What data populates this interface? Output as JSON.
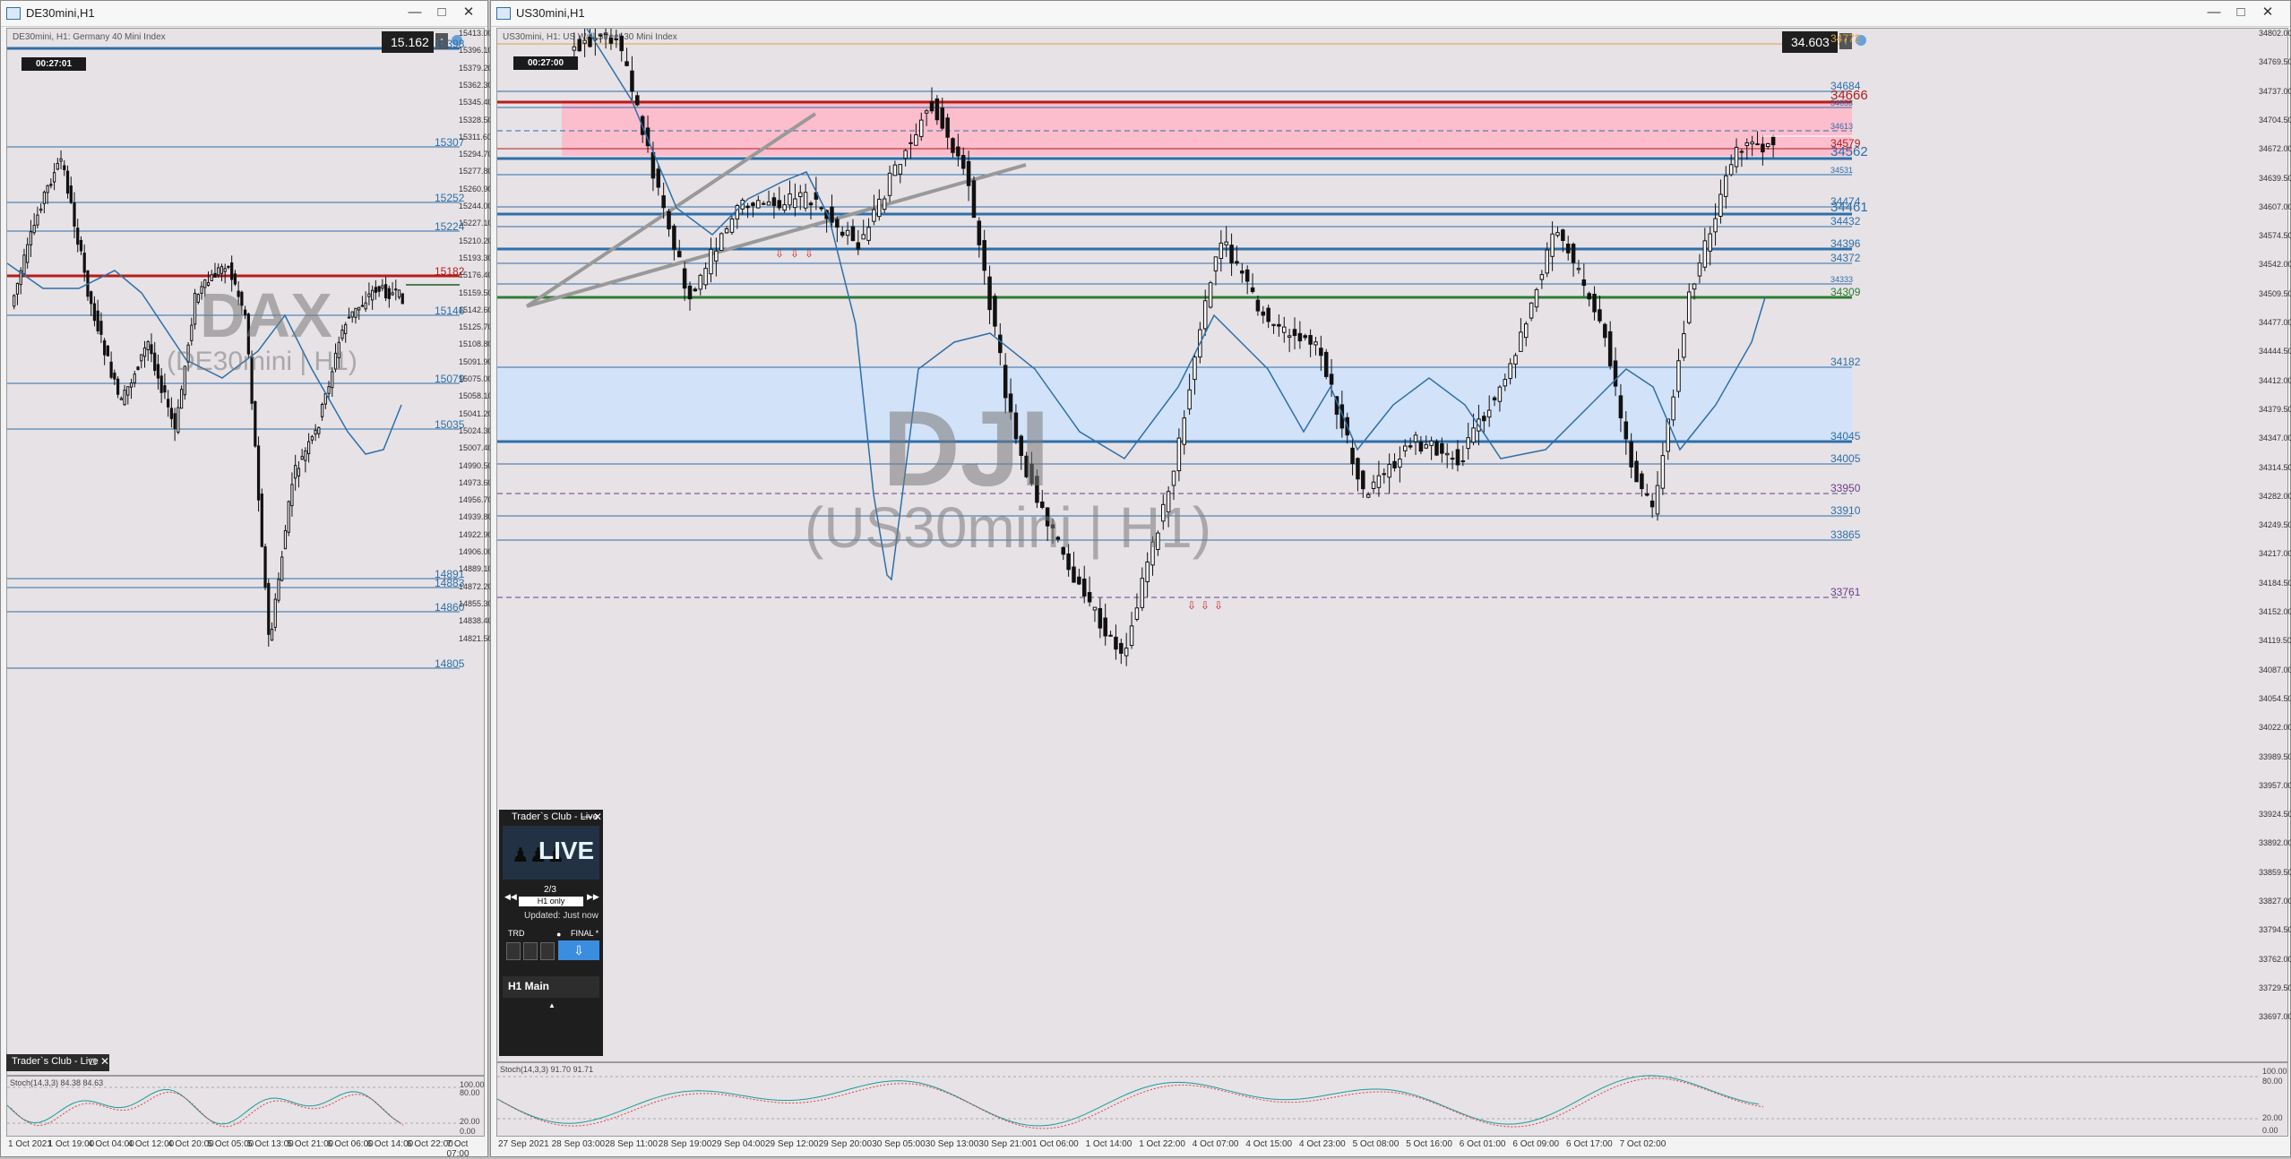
{
  "left": {
    "title": "DE30mini,H1",
    "info": "DE30mini, H1:  Germany 40 Mini Index",
    "timer": "00:27:01",
    "price": "15.162",
    "watermark_main": "DAX",
    "watermark_sub": "(DE30mini | H1)",
    "levels": [
      "15398",
      "15307",
      "15252",
      "15224",
      "15182",
      "15182",
      "15146",
      "15079",
      "15035",
      "14891",
      "14883",
      "14860",
      "14805"
    ],
    "price_axis": [
      "15413.00",
      "15396.10",
      "15379.20",
      "15362.30",
      "15345.40",
      "15328.50",
      "15311.60",
      "15294.70",
      "15277.80",
      "15260.90",
      "15244.00",
      "15227.10",
      "15210.20",
      "15193.30",
      "15176.40",
      "15159.50",
      "15142.60",
      "15125.70",
      "15108.80",
      "15091.90",
      "15075.00",
      "15058.10",
      "15041.20",
      "15024.30",
      "15007.40",
      "14990.50",
      "14973.60",
      "14956.70",
      "14939.80",
      "14922.90",
      "14906.00",
      "14889.10",
      "14872.20",
      "14855.30",
      "14838.40",
      "14821.50"
    ],
    "time_axis": [
      "1 Oct 2021",
      "1 Oct 19:00",
      "4 Oct 04:00",
      "4 Oct 12:00",
      "4 Oct 20:00",
      "5 Oct 05:00",
      "5 Oct 13:00",
      "5 Oct 21:00",
      "6 Oct 06:00",
      "6 Oct 14:00",
      "6 Oct 22:00",
      "7 Oct 07:00"
    ],
    "panel_title": "Trader`s Club - Live",
    "stoch_label": "Stoch(14,3,3) 84.38 84.63",
    "stoch_axis": [
      "100.00",
      "80.00",
      "20.00",
      "0.00"
    ]
  },
  "right": {
    "title": "US30mini,H1",
    "info": "US30mini, H1:  US Wall Street 30 Mini Index",
    "timer": "00:27:00",
    "price": "34.603",
    "watermark_main": "DJI",
    "watermark_sub": "(US30mini | H1)",
    "levels": [
      "34772",
      "34684",
      "34666",
      "34653",
      "34613",
      "34579",
      "34562",
      "34531",
      "34474",
      "34461",
      "34432",
      "34396",
      "34372",
      "34333",
      "34309",
      "34182",
      "34045",
      "34005",
      "33950",
      "33910",
      "33865",
      "33761"
    ],
    "price_axis": [
      "34802.00",
      "34769.50",
      "34737.00",
      "34704.50",
      "34672.00",
      "34639.50",
      "34607.00",
      "34574.50",
      "34542.00",
      "34509.50",
      "34477.00",
      "34444.50",
      "34412.00",
      "34379.50",
      "34347.00",
      "34314.50",
      "34282.00",
      "34249.50",
      "34217.00",
      "34184.50",
      "34152.00",
      "34119.50",
      "34087.00",
      "34054.50",
      "34022.00",
      "33989.50",
      "33957.00",
      "33924.50",
      "33892.00",
      "33859.50",
      "33827.00",
      "33794.50",
      "33762.00",
      "33729.50",
      "33697.00"
    ],
    "time_axis": [
      "27 Sep 2021",
      "28 Sep 03:00",
      "28 Sep 11:00",
      "28 Sep 19:00",
      "29 Sep 04:00",
      "29 Sep 12:00",
      "29 Sep 20:00",
      "30 Sep 05:00",
      "30 Sep 13:00",
      "30 Sep 21:00",
      "1 Oct 06:00",
      "1 Oct 14:00",
      "1 Oct 22:00",
      "4 Oct 07:00",
      "4 Oct 15:00",
      "4 Oct 23:00",
      "5 Oct 08:00",
      "5 Oct 16:00",
      "6 Oct 01:00",
      "6 Oct 09:00",
      "6 Oct 17:00",
      "7 Oct 02:00"
    ],
    "stoch_label": "Stoch(14,3,3) 91.70 91.71",
    "stoch_axis": [
      "100.00",
      "80.00",
      "20.00",
      "0.00"
    ]
  },
  "widget": {
    "title": "Trader`s Club - Live",
    "live": "LIVE",
    "page": "2/3",
    "filter": "H1 only",
    "updated": "Updated: Just now",
    "trd": "TRD",
    "final": "FINAL *",
    "main": "H1 Main"
  },
  "colors": {
    "resistance_zone": "#ffb6c8",
    "support_zone": "#cfe2fa",
    "level_blue": "#2e6fa8",
    "level_red": "#b71c1c",
    "level_green": "#2e7d32",
    "level_orange": "#e0a040",
    "ma": "#2e6fa8"
  }
}
